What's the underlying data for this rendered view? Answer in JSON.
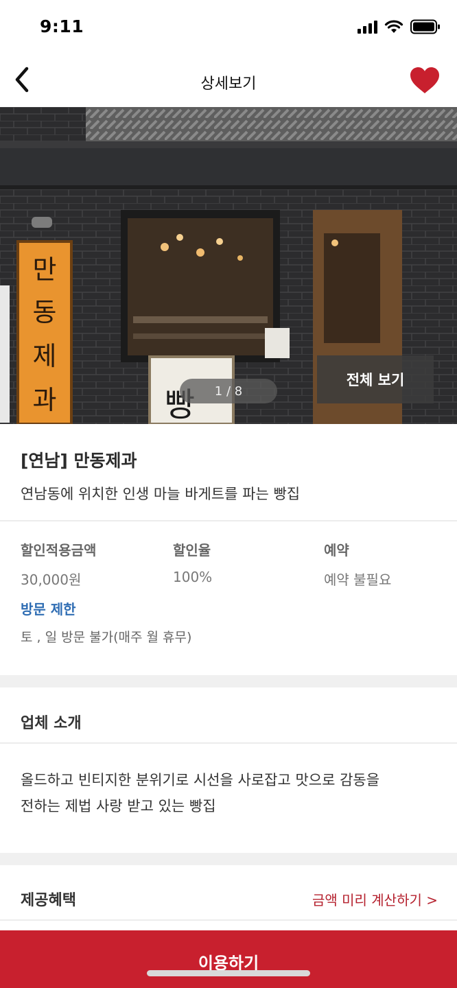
{
  "status_bar": {
    "time": "9:11"
  },
  "nav": {
    "title": "상세보기"
  },
  "hero": {
    "counter": "1 / 8",
    "view_all": "전체 보기",
    "sign_chars": [
      "만",
      "동",
      "제",
      "과"
    ],
    "board_text": "빵"
  },
  "store": {
    "name": "[연남] 만동제과",
    "description": "연남동에 위치한 인생 마늘 바게트를 파는 빵집"
  },
  "info": {
    "discount_amount_label": "할인적용금액",
    "discount_amount_value": "30,000원",
    "discount_rate_label": "할인율",
    "discount_rate_value": "100%",
    "reservation_label": "예약",
    "reservation_value": "예약 불필요",
    "visit_limit_label": "방문 제한",
    "visit_limit_value": "토 , 일 방문 불가(매주 월 휴무)"
  },
  "intro": {
    "title": "업체 소개",
    "text_line1": "올드하고 빈티지한 분위기로 시선을 사로잡고 맛으로 감동을",
    "text_line2": "전하는 제법 사랑 받고 있는 빵집"
  },
  "benefits": {
    "title": "제공혜택",
    "calc_link": "금액 미리 계산하기 >"
  },
  "cta": {
    "label": "이용하기"
  },
  "colors": {
    "accent_red": "#c8202e",
    "link_blue": "#2f6db3",
    "heart_red": "#c8202e"
  }
}
